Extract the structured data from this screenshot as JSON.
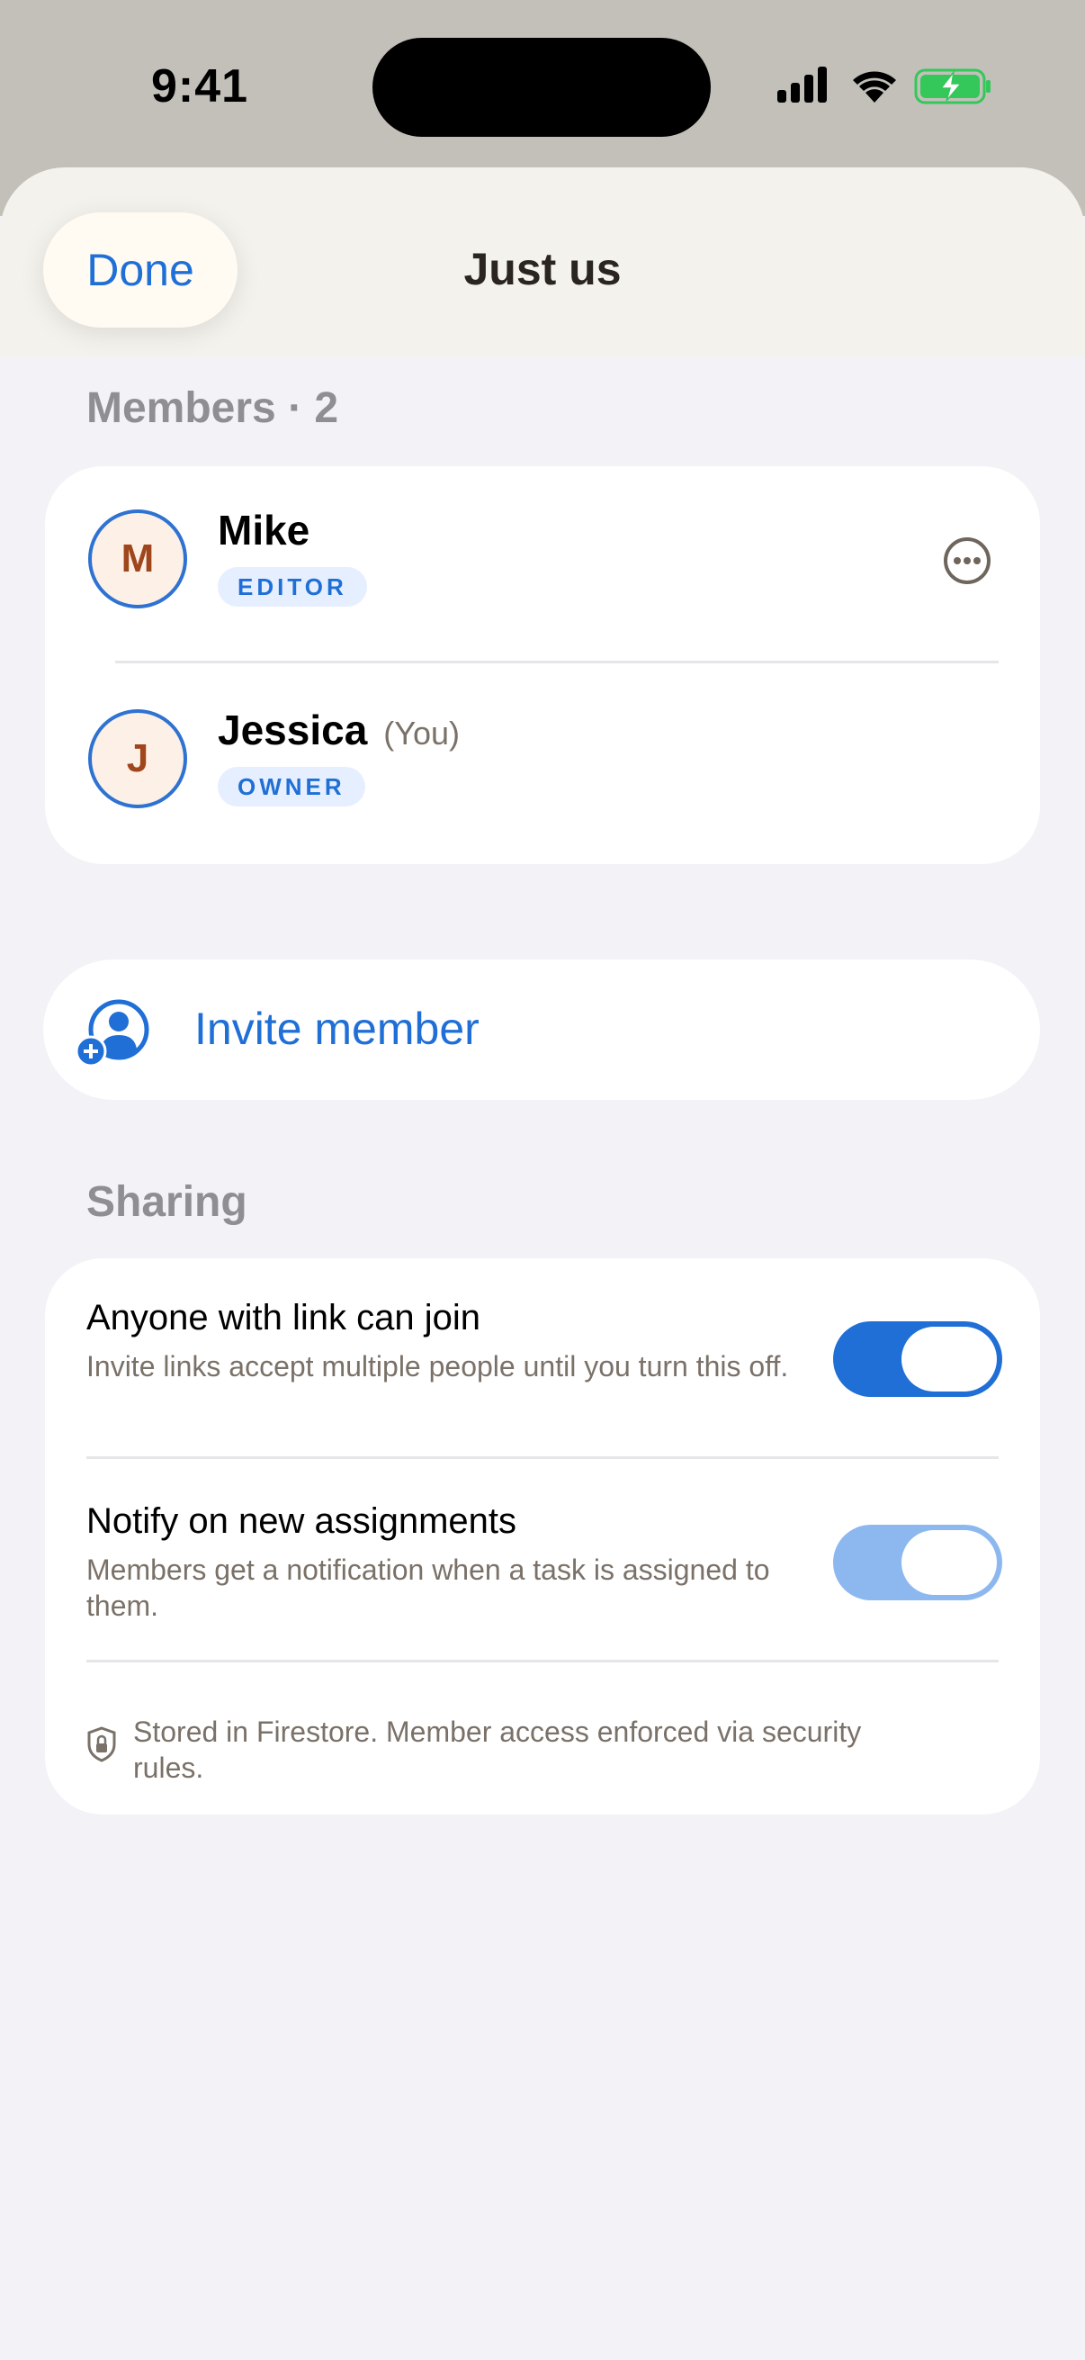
{
  "status_bar": {
    "time": "9:41",
    "icons": [
      "cellular-signal-icon",
      "wifi-icon",
      "battery-charging-icon"
    ]
  },
  "header": {
    "done_label": "Done",
    "title": "Just us"
  },
  "members": {
    "section_label": "Members · 2",
    "items": [
      {
        "initial": "M",
        "name": "Mike",
        "you_label": "",
        "role": "EDITOR",
        "has_menu": true
      },
      {
        "initial": "J",
        "name": "Jessica",
        "you_label": "(You)",
        "role": "OWNER",
        "has_menu": false
      }
    ]
  },
  "invite": {
    "label": "Invite member",
    "icon": "add-person-icon"
  },
  "sharing": {
    "section_label": "Sharing",
    "settings": [
      {
        "title": "Anyone with link can join",
        "description": "Invite links accept multiple people until you turn this off.",
        "enabled": true
      },
      {
        "title": "Notify on new assignments",
        "description": "Members get a notification when a task is assigned to them.",
        "enabled": true
      }
    ],
    "footnote": "Stored in Firestore. Member access enforced via security rules.",
    "footnote_icon": "lock-shield-icon"
  },
  "colors": {
    "accent": "#1f6fd6",
    "toggle_on": "#1f6fd6",
    "toggle_on_dimmed": "#8db8ef",
    "avatar_initial": "#a0461c"
  }
}
